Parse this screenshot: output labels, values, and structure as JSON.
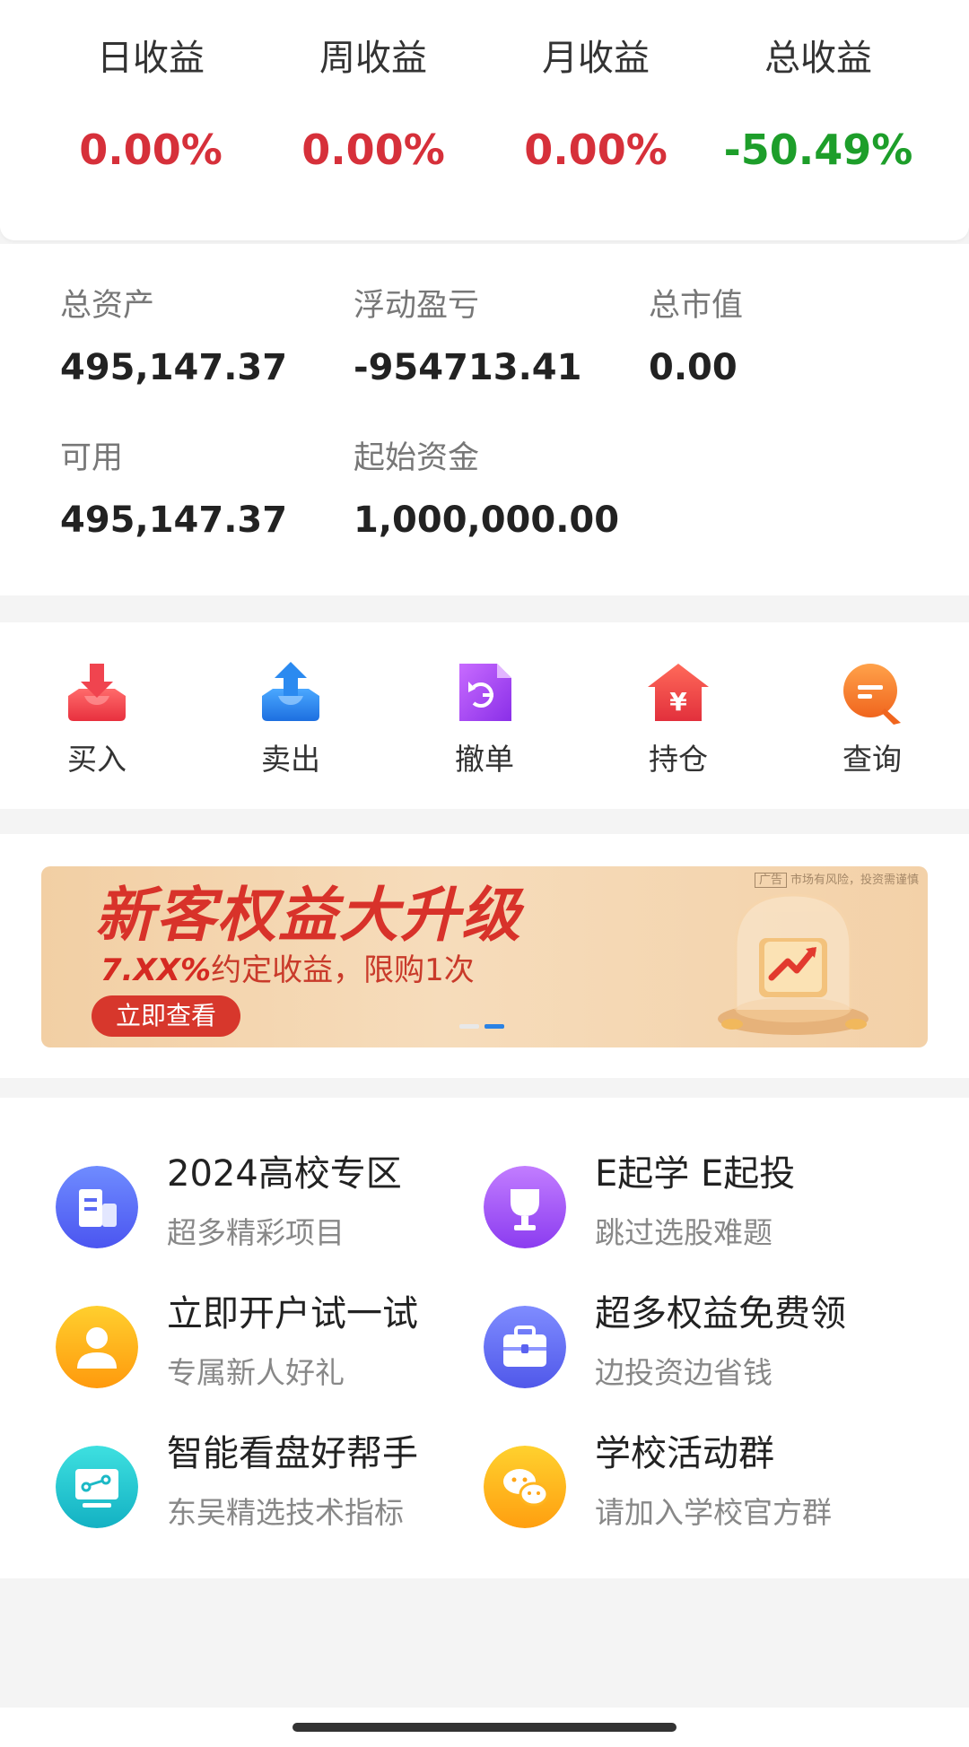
{
  "returns": [
    {
      "label": "日收益",
      "value": "0.00%",
      "color": "#d6303a"
    },
    {
      "label": "周收益",
      "value": "0.00%",
      "color": "#d6303a"
    },
    {
      "label": "月收益",
      "value": "0.00%",
      "color": "#d6303a"
    },
    {
      "label": "总收益",
      "value": "-50.49%",
      "color": "#1d9e2a"
    }
  ],
  "assets": {
    "total_assets": {
      "label": "总资产",
      "value": "495,147.37"
    },
    "floating_pnl": {
      "label": "浮动盈亏",
      "value": "-954713.41"
    },
    "market_value": {
      "label": "总市值",
      "value": "0.00"
    },
    "available": {
      "label": "可用",
      "value": "495,147.37"
    },
    "initial_capital": {
      "label": "起始资金",
      "value": "1,000,000.00"
    }
  },
  "actions": [
    {
      "label": "买入",
      "icon": "buy-icon"
    },
    {
      "label": "卖出",
      "icon": "sell-icon"
    },
    {
      "label": "撤单",
      "icon": "cancel-order-icon"
    },
    {
      "label": "持仓",
      "icon": "holdings-icon"
    },
    {
      "label": "查询",
      "icon": "query-icon"
    }
  ],
  "banner": {
    "title": "新客权益大升级",
    "subtitle_highlight": "7.XX%",
    "subtitle_rest": "约定收益，限购1次",
    "button": "立即查看",
    "ad_tag": "广告",
    "ad_note": "市场有风险，投资需谨慎",
    "slides": 2,
    "active_slide": 2
  },
  "features": [
    {
      "title": "2024高校专区",
      "subtitle": "超多精彩项目",
      "icon": "building-icon"
    },
    {
      "title": "E起学 E起投",
      "subtitle": "跳过选股难题",
      "icon": "trophy-icon"
    },
    {
      "title": "立即开户试一试",
      "subtitle": "专属新人好礼",
      "icon": "user-icon"
    },
    {
      "title": "超多权益免费领",
      "subtitle": "边投资边省钱",
      "icon": "briefcase-icon"
    },
    {
      "title": "智能看盘好帮手",
      "subtitle": "东吴精选技术指标",
      "icon": "chart-screen-icon"
    },
    {
      "title": "学校活动群",
      "subtitle": "请加入学校官方群",
      "icon": "chat-icon"
    }
  ],
  "colors": {
    "up": "#d6303a",
    "down": "#1d9e2a",
    "accent": "#2a82e4"
  }
}
